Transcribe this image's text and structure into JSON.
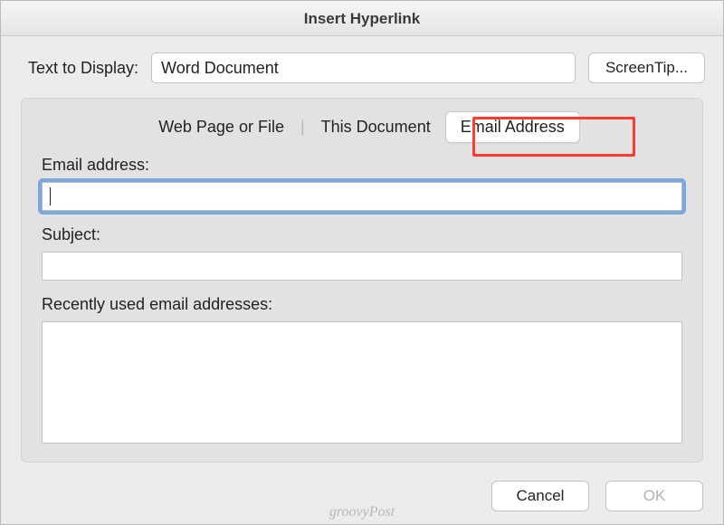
{
  "title": "Insert Hyperlink",
  "topRow": {
    "label": "Text to Display:",
    "value": "Word Document",
    "screenTipLabel": "ScreenTip..."
  },
  "tabs": {
    "items": [
      {
        "label": "Web Page or File"
      },
      {
        "label": "This Document"
      },
      {
        "label": "Email Address"
      }
    ],
    "separator": "|"
  },
  "fields": {
    "emailLabel": "Email address:",
    "emailValue": "",
    "subjectLabel": "Subject:",
    "subjectValue": "",
    "recentLabel": "Recently used email addresses:"
  },
  "footer": {
    "cancel": "Cancel",
    "ok": "OK"
  },
  "watermark": "groovyPost"
}
